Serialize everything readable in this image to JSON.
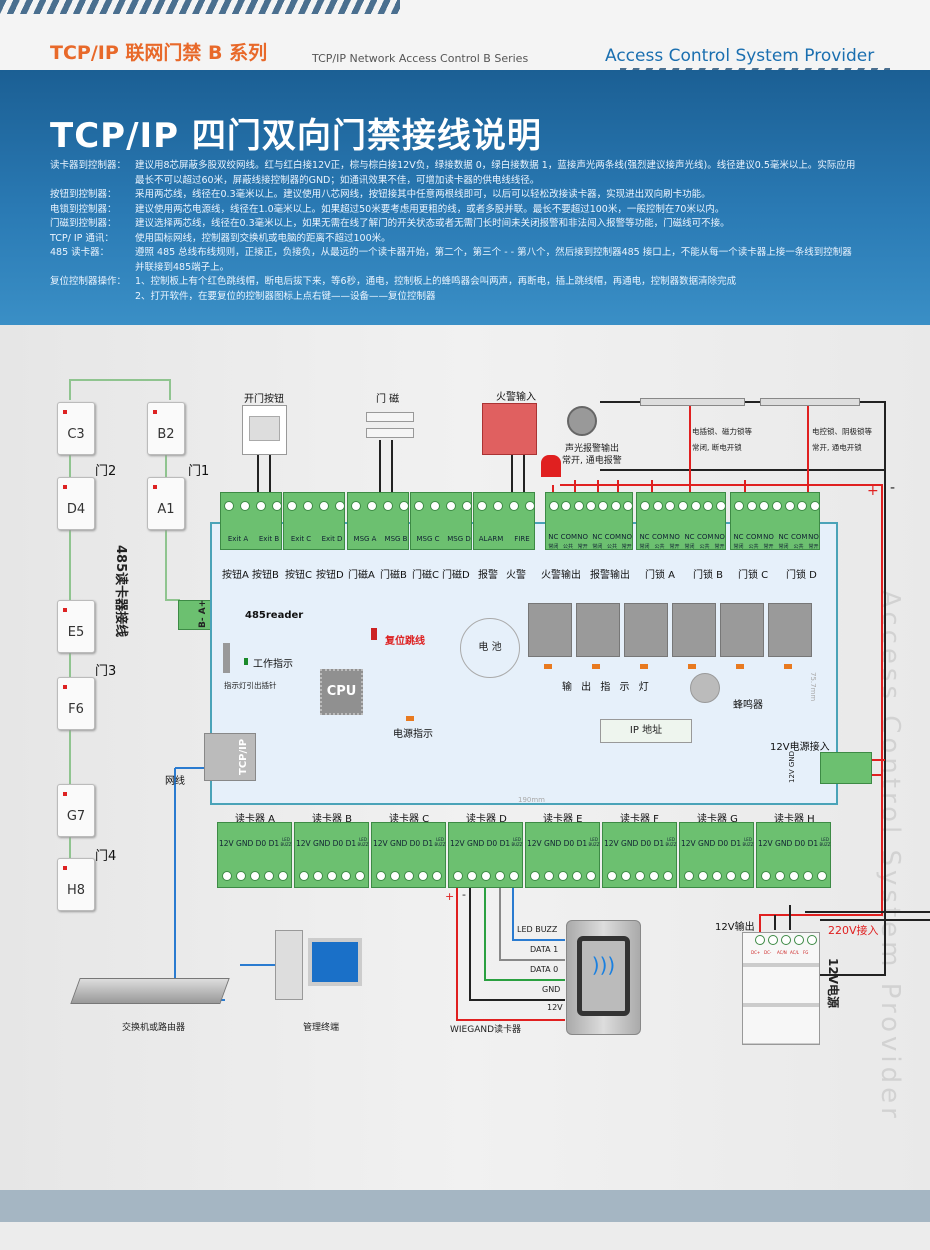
{
  "header": {
    "series": "TCP/IP 联网门禁 B 系列",
    "series_en": "TCP/IP Network Access Control  B  Series",
    "provider": "Access Control System Provider",
    "title": "TCP/IP 四门双向门禁接线说明"
  },
  "notes": [
    {
      "label": "读卡器到控制器：",
      "lines": [
        "建议用8芯屏蔽多股双绞网线。红与红白接12V正，棕与棕白接12V负，绿接数据 0，绿白接数据 1，蓝接声光两条线(强烈建议接声光线)。线径建议0.5毫米以上。实际应用",
        "最长不可以超过60米，屏蔽线接控制器的GND；如通讯效果不佳，可增加读卡器的供电线线径。"
      ]
    },
    {
      "label": "按钮到控制器：",
      "lines": [
        "采用两芯线，线径在0.3毫米以上。建议使用八芯网线，按钮接其中任意两根线即可，以后可以轻松改接读卡器，实现进出双向刷卡功能。"
      ]
    },
    {
      "label": "电锁到控制器：",
      "lines": [
        "建议使用两芯电源线，线径在1.0毫米以上。如果超过50米要考虑用更粗的线，或者多股并联。最长不要超过100米，一般控制在70米以内。"
      ]
    },
    {
      "label": "门磁到控制器：",
      "lines": [
        "建议选择两芯线，线径在0.3毫米以上，如果无需在线了解门的开关状态或者无需门长时间未关闭报警和非法闯入报警等功能，门磁线可不接。"
      ]
    },
    {
      "label": "TCP/ IP 通讯：",
      "lines": [
        "使用国标网线，控制器到交换机或电脑的距离不超过100米。"
      ]
    },
    {
      "label": "485 读卡器：",
      "lines": [
        "遵照 485 总线布线规则，正接正，负接负，从最远的一个读卡器开始，第二个，第三个 - - 第八个，然后接到控制器485 接口上，不能从每一个读卡器上接一条线到控制器",
        "并联接到485端子上。"
      ]
    },
    {
      "label": "复位控制器操作：",
      "lines": [
        "1、控制板上有个红色跳线帽，断电后拔下来，等6秒，通电，控制板上的蜂鸣器会叫两声，再断电，插上跳线帽，再通电，控制器数据清除完成",
        "2、打开软件，在要复位的控制器图标上点右键——设备——复位控制器"
      ]
    }
  ],
  "devices": {
    "exit_button": "开门按钮",
    "door_sensor": "门 磁",
    "fire_input": "火警输入",
    "siren": "声光报警输出",
    "siren_note": "常开, 通电报警",
    "lock1": "电插锁、磁力锁等",
    "lock1_note": "常闭, 断电开锁",
    "lock2": "电控锁、阴极锁等",
    "lock2_note": "常开, 通电开锁"
  },
  "readers_485": {
    "cards": [
      "C3",
      "D4",
      "E5",
      "F6",
      "G7",
      "H8",
      "B2",
      "A1"
    ],
    "doors": [
      "门2",
      "门1",
      "门3",
      "门4"
    ],
    "label": "485读卡器接线",
    "terminal": "B-  A+",
    "port_label": "485reader"
  },
  "top_terminals": {
    "labels": [
      "Exit A",
      "Exit B",
      "Exit C",
      "Exit D",
      "MSG A",
      "MSG B",
      "MSG C",
      "MSG D",
      "ALARM",
      "FIRE"
    ],
    "relay_pins": [
      "NC",
      "COM",
      "NO"
    ],
    "relay_pins_cn": [
      "常闭",
      "公共",
      "常开"
    ],
    "names": [
      "按钮A",
      "按钮B",
      "按钮C",
      "按钮D",
      "门磁A",
      "门磁B",
      "门磁C",
      "门磁D",
      "报警",
      "火警",
      "火警输出",
      "报警输出",
      "门锁 A",
      "门锁 B",
      "门锁 C",
      "门锁 D"
    ]
  },
  "board": {
    "reset_jumper": "复位跳线",
    "work_indicator": "工作指示",
    "indicator_pins": "指示灯引出插针",
    "battery": "电 池",
    "cpu": "CPU",
    "power_indicator": "电源指示",
    "output_leds": "输 出 指 示 灯",
    "buzzer": "蜂鸣器",
    "ip_address": "IP 地址",
    "rj45": "TCP/IP",
    "power_in": "12V电源接入",
    "power_pins": "12V  GND",
    "width_dim": "190mm",
    "height_dim": "75.7mm",
    "plus": "+",
    "minus": "-"
  },
  "reader_ports": {
    "names": [
      "读卡器 A",
      "读卡器 B",
      "读卡器 C",
      "读卡器 D",
      "读卡器 E",
      "读卡器 F",
      "读卡器 G",
      "读卡器 H"
    ],
    "pins": "12V GND D0 D1",
    "led": "LED BUZZ"
  },
  "network": {
    "cable": "网线",
    "switch": "交换机或路由器",
    "terminal": "管理终端"
  },
  "wiegand": {
    "title": "WIEGAND读卡器",
    "wires": [
      "LED BUZZ",
      "DATA 1",
      "DATA 0",
      "GND",
      "12V"
    ],
    "plus": "+",
    "minus": "-"
  },
  "psu": {
    "output": "12V输出",
    "input": "220V接入",
    "label": "12V电源",
    "pins": [
      "DC+",
      "DC-",
      "AC/N",
      "AC/L",
      "FG"
    ]
  },
  "colors": {
    "banner": "#1b5f94",
    "accent": "#e8692a",
    "terminal": "#6cc070",
    "wire_red": "#e02020"
  }
}
